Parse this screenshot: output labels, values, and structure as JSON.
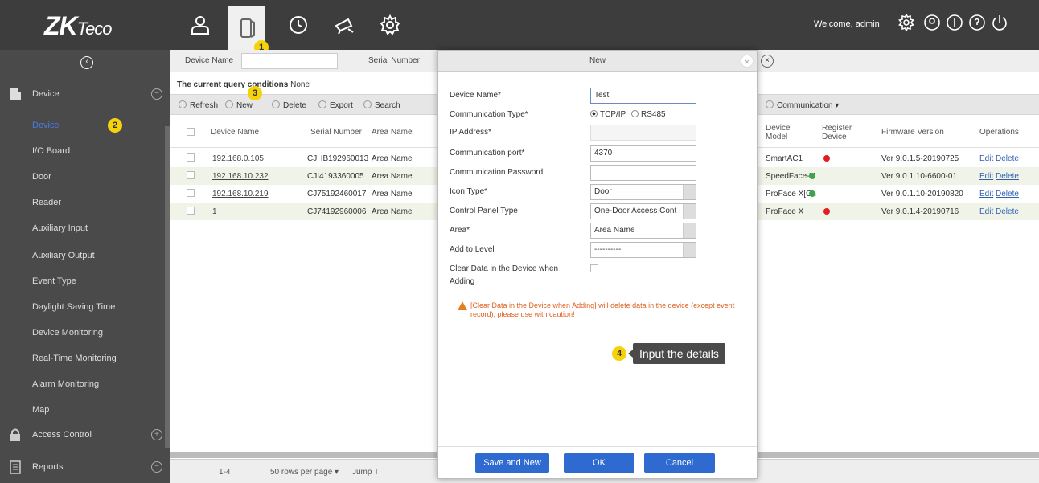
{
  "logo": {
    "main": "ZK",
    "sub": "Teco"
  },
  "header": {
    "welcome": "Welcome, admin"
  },
  "markers": {
    "m1": "1",
    "m2": "2",
    "m3": "3",
    "m4": "4"
  },
  "sidebar": {
    "sections": [
      {
        "label": "Device"
      },
      {
        "label": "Access Control"
      },
      {
        "label": "Reports"
      }
    ],
    "items": [
      {
        "label": "Device"
      },
      {
        "label": "I/O Board"
      },
      {
        "label": "Door"
      },
      {
        "label": "Reader"
      },
      {
        "label": "Auxiliary Input"
      },
      {
        "label": "Auxiliary Output"
      },
      {
        "label": "Event Type"
      },
      {
        "label": "Daylight Saving Time"
      },
      {
        "label": "Device Monitoring"
      },
      {
        "label": "Real-Time Monitoring"
      },
      {
        "label": "Alarm Monitoring"
      },
      {
        "label": "Map"
      }
    ]
  },
  "filter": {
    "device_name_label": "Device Name",
    "serial_label": "Serial Number"
  },
  "query": {
    "label": "The current query conditions",
    "value": "None"
  },
  "toolbar": {
    "refresh": "Refresh",
    "new": "New",
    "delete": "Delete",
    "export": "Export",
    "search": "Search",
    "communication": "Communication"
  },
  "table": {
    "headers": {
      "device_name": "Device Name",
      "serial": "Serial Number",
      "area": "Area Name",
      "model": "Device Model",
      "register": "Register Device",
      "firmware": "Firmware Version",
      "operations": "Operations"
    },
    "rows": [
      {
        "name": "192.168.0.105",
        "serial": "CJHB192960013",
        "area": "Area Name",
        "model": "SmartAC1",
        "status": "red",
        "firmware": "Ver 9.0.1.5-20190725",
        "edit": "Edit",
        "delete": "Delete"
      },
      {
        "name": "192.168.10.232",
        "serial": "CJI4193360005",
        "area": "Area Name",
        "model": "SpeedFace-V",
        "status": "green",
        "firmware": "Ver 9.0.1.10-6600-01",
        "edit": "Edit",
        "delete": "Delete"
      },
      {
        "name": "192.168.10.219",
        "serial": "CJ75192460017",
        "area": "Area Name",
        "model": "ProFace X[Ch",
        "status": "green",
        "firmware": "Ver 9.0.1.10-20190820",
        "edit": "Edit",
        "delete": "Delete"
      },
      {
        "name": "1",
        "serial": "CJ74192960006",
        "area": "Area Name",
        "model": "ProFace X",
        "status": "red",
        "firmware": "Ver 9.0.1.4-20190716",
        "edit": "Edit",
        "delete": "Delete"
      }
    ]
  },
  "pager": {
    "range": "1-4",
    "per_page": "50 rows per page",
    "jump": "Jump T"
  },
  "modal": {
    "title": "New",
    "fields": {
      "device_name_label": "Device Name*",
      "device_name_value": "Test",
      "comm_type_label": "Communication Type*",
      "comm_tcp": "TCP/IP",
      "comm_rs485": "RS485",
      "ip_label": "IP Address*",
      "port_label": "Communication port*",
      "port_value": "4370",
      "password_label": "Communication Password",
      "icon_type_label": "Icon Type*",
      "icon_type_value": "Door",
      "panel_type_label": "Control Panel Type",
      "panel_type_value": "One-Door Access Cont",
      "area_label": "Area*",
      "area_value": "Area Name",
      "level_label": "Add to Level",
      "level_value": "----------",
      "clear_label_1": "Clear Data in the Device when",
      "clear_label_2": "Adding"
    },
    "warning": "[Clear Data in the Device when Adding] will delete data in the device (except event record), please use with caution!",
    "tooltip": "Input the details",
    "buttons": {
      "save_new": "Save and New",
      "ok": "OK",
      "cancel": "Cancel"
    }
  },
  "colors": {
    "topbar": "#3d3d3d",
    "sidebar": "#4a4a4a",
    "accent": "#2e6ad0",
    "marker": "#f5d20a",
    "warning": "#e06020"
  }
}
